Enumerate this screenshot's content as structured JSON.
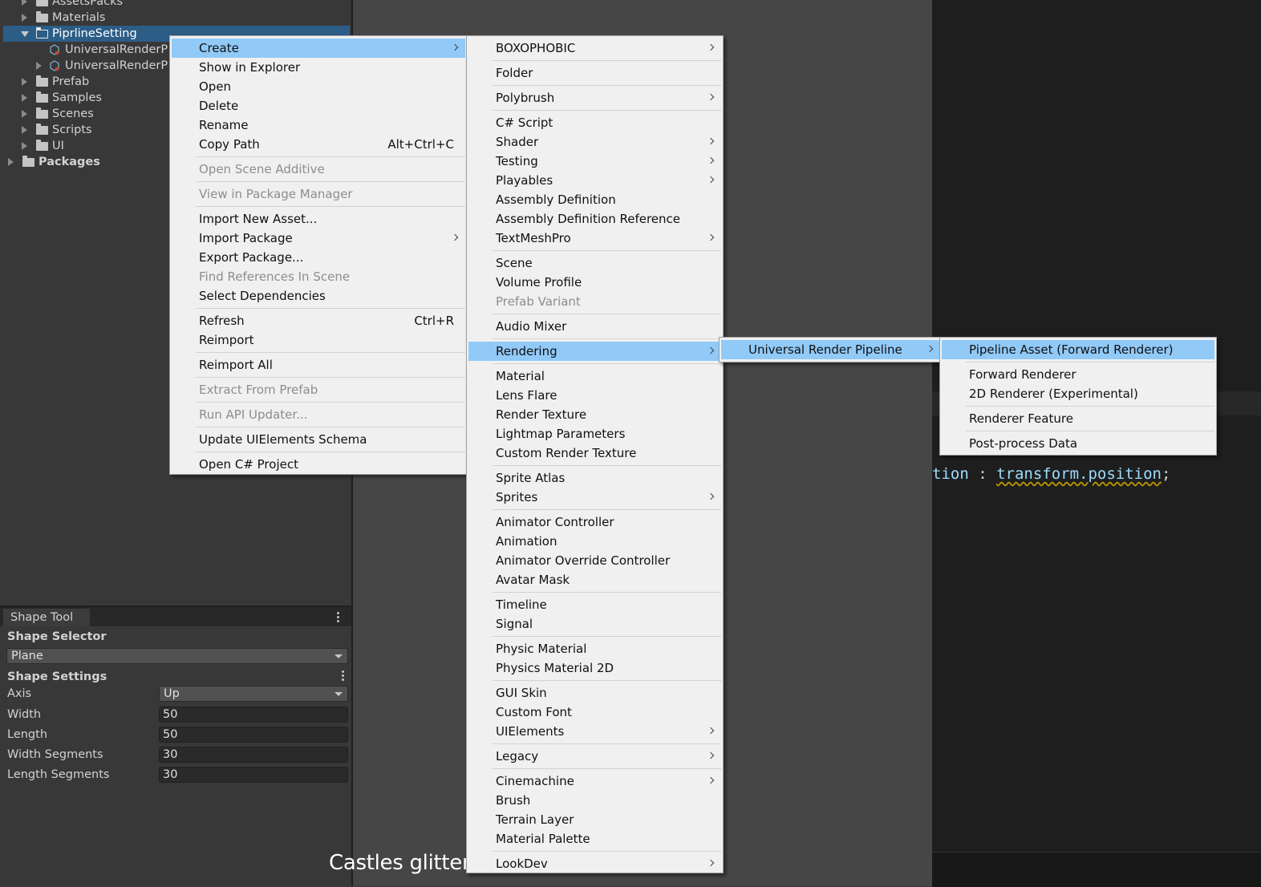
{
  "project_tree": [
    {
      "label": "AssetsPacks",
      "indent": 1,
      "type": "folder"
    },
    {
      "label": "Materials",
      "indent": 1,
      "type": "folder"
    },
    {
      "label": "PiprlineSetting",
      "indent": 1,
      "type": "folder-open",
      "selected": true
    },
    {
      "label": "UniversalRenderP",
      "indent": 2,
      "type": "asset"
    },
    {
      "label": "UniversalRenderP",
      "indent": 2,
      "type": "asset",
      "arrow": true
    },
    {
      "label": "Prefab",
      "indent": 1,
      "type": "folder"
    },
    {
      "label": "Samples",
      "indent": 1,
      "type": "folder"
    },
    {
      "label": "Scenes",
      "indent": 1,
      "type": "folder"
    },
    {
      "label": "Scripts",
      "indent": 1,
      "type": "folder"
    },
    {
      "label": "UI",
      "indent": 1,
      "type": "folder"
    },
    {
      "label": "Packages",
      "indent": 0,
      "type": "folder",
      "bold": true
    }
  ],
  "shape_tool": {
    "tab": "Shape Tool",
    "selector_label": "Shape Selector",
    "selector_value": "Plane",
    "settings_label": "Shape Settings",
    "axis_label": "Axis",
    "axis_value": "Up",
    "fields": [
      {
        "label": "Width",
        "value": "50"
      },
      {
        "label": "Length",
        "value": "50"
      },
      {
        "label": "Width Segments",
        "value": "30"
      },
      {
        "label": "Length Segments",
        "value": "30"
      }
    ]
  },
  "caption": "Castles glitter",
  "code": {
    "part1": "tion",
    "op": " : ",
    "part2": "transform.position",
    "end": ";"
  },
  "context_menu": [
    {
      "label": "Create",
      "sub": true,
      "hl": true
    },
    {
      "label": "Show in Explorer"
    },
    {
      "label": "Open"
    },
    {
      "label": "Delete"
    },
    {
      "label": "Rename"
    },
    {
      "label": "Copy Path",
      "shortcut": "Alt+Ctrl+C"
    },
    {
      "sep": true
    },
    {
      "label": "Open Scene Additive",
      "disabled": true
    },
    {
      "sep": true
    },
    {
      "label": "View in Package Manager",
      "disabled": true
    },
    {
      "sep": true
    },
    {
      "label": "Import New Asset..."
    },
    {
      "label": "Import Package",
      "sub": true
    },
    {
      "label": "Export Package..."
    },
    {
      "label": "Find References In Scene",
      "disabled": true
    },
    {
      "label": "Select Dependencies"
    },
    {
      "sep": true
    },
    {
      "label": "Refresh",
      "shortcut": "Ctrl+R"
    },
    {
      "label": "Reimport"
    },
    {
      "sep": true
    },
    {
      "label": "Reimport All"
    },
    {
      "sep": true
    },
    {
      "label": "Extract From Prefab",
      "disabled": true
    },
    {
      "sep": true
    },
    {
      "label": "Run API Updater...",
      "disabled": true
    },
    {
      "sep": true
    },
    {
      "label": "Update UIElements Schema"
    },
    {
      "sep": true
    },
    {
      "label": "Open C# Project"
    }
  ],
  "create_menu": [
    {
      "label": "BOXOPHOBIC",
      "sub": true
    },
    {
      "sep": true
    },
    {
      "label": "Folder"
    },
    {
      "sep": true
    },
    {
      "label": "Polybrush",
      "sub": true
    },
    {
      "sep": true
    },
    {
      "label": "C# Script"
    },
    {
      "label": "Shader",
      "sub": true
    },
    {
      "label": "Testing",
      "sub": true
    },
    {
      "label": "Playables",
      "sub": true
    },
    {
      "label": "Assembly Definition"
    },
    {
      "label": "Assembly Definition Reference"
    },
    {
      "label": "TextMeshPro",
      "sub": true
    },
    {
      "sep": true
    },
    {
      "label": "Scene"
    },
    {
      "label": "Volume Profile"
    },
    {
      "label": "Prefab Variant",
      "disabled": true
    },
    {
      "sep": true
    },
    {
      "label": "Audio Mixer"
    },
    {
      "sep": true
    },
    {
      "label": "Rendering",
      "sub": true,
      "hl": true
    },
    {
      "sep": true
    },
    {
      "label": "Material"
    },
    {
      "label": "Lens Flare"
    },
    {
      "label": "Render Texture"
    },
    {
      "label": "Lightmap Parameters"
    },
    {
      "label": "Custom Render Texture"
    },
    {
      "sep": true
    },
    {
      "label": "Sprite Atlas"
    },
    {
      "label": "Sprites",
      "sub": true
    },
    {
      "sep": true
    },
    {
      "label": "Animator Controller"
    },
    {
      "label": "Animation"
    },
    {
      "label": "Animator Override Controller"
    },
    {
      "label": "Avatar Mask"
    },
    {
      "sep": true
    },
    {
      "label": "Timeline"
    },
    {
      "label": "Signal"
    },
    {
      "sep": true
    },
    {
      "label": "Physic Material"
    },
    {
      "label": "Physics Material 2D"
    },
    {
      "sep": true
    },
    {
      "label": "GUI Skin"
    },
    {
      "label": "Custom Font"
    },
    {
      "label": "UIElements",
      "sub": true
    },
    {
      "sep": true
    },
    {
      "label": "Legacy",
      "sub": true
    },
    {
      "sep": true
    },
    {
      "label": "Cinemachine",
      "sub": true
    },
    {
      "label": "Brush"
    },
    {
      "label": "Terrain Layer"
    },
    {
      "label": "Material Palette"
    },
    {
      "sep": true
    },
    {
      "label": "LookDev",
      "sub": true
    }
  ],
  "rendering_menu": [
    {
      "label": "Universal Render Pipeline",
      "sub": true,
      "hl": true
    }
  ],
  "urp_menu": [
    {
      "label": "Pipeline Asset (Forward Renderer)",
      "hl": true
    },
    {
      "sep": true
    },
    {
      "label": "Forward Renderer"
    },
    {
      "label": "2D Renderer (Experimental)"
    },
    {
      "sep": true
    },
    {
      "label": "Renderer Feature"
    },
    {
      "sep": true
    },
    {
      "label": "Post-process Data"
    }
  ]
}
